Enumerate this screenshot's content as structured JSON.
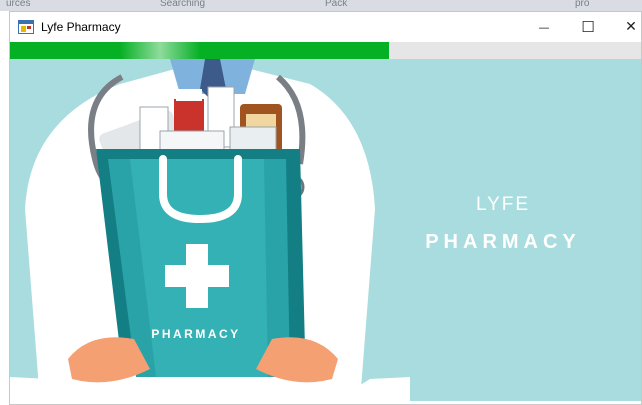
{
  "window": {
    "title": "Lyfe Pharmacy",
    "minimize_glyph": "—",
    "maximize_glyph": "☐",
    "close_glyph": "✕"
  },
  "loading": {
    "progress": 0.6,
    "fill_color": "#06b025"
  },
  "splash": {
    "bag_label": "PHARMACY",
    "brand_line1": "LYFE",
    "brand_line2": "PHARMACY",
    "background_color": "#a9dcdf"
  },
  "background_window": {
    "partial_text": [
      "urces",
      "Searching",
      "Pack",
      "pro"
    ]
  }
}
